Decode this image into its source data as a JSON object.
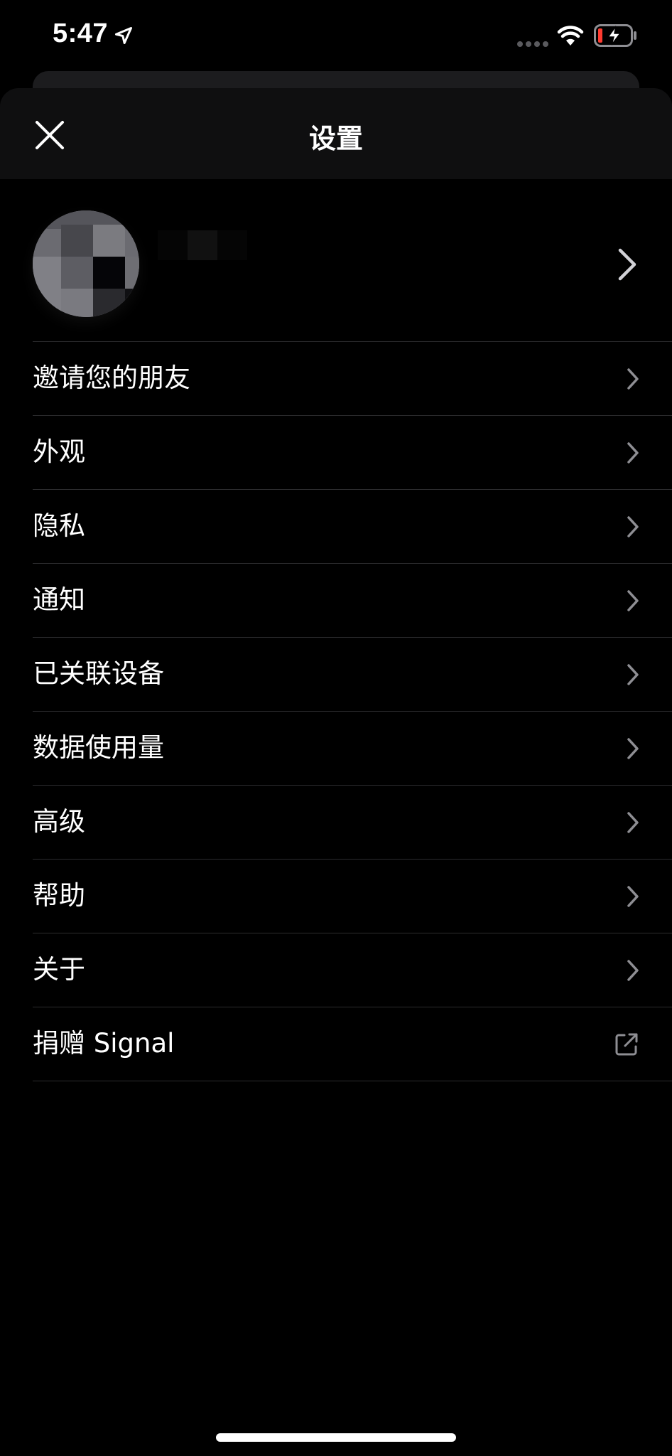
{
  "status_bar": {
    "time": "5:47"
  },
  "header": {
    "title": "设置",
    "close_icon": "close-icon"
  },
  "profile": {
    "chevron_icon": "chevron-right-icon"
  },
  "menu": {
    "items": [
      {
        "label": "邀请您的朋友",
        "icon": "chevron-right-icon"
      },
      {
        "label": "外观",
        "icon": "chevron-right-icon"
      },
      {
        "label": "隐私",
        "icon": "chevron-right-icon"
      },
      {
        "label": "通知",
        "icon": "chevron-right-icon"
      },
      {
        "label": "已关联设备",
        "icon": "chevron-right-icon"
      },
      {
        "label": "数据使用量",
        "icon": "chevron-right-icon"
      },
      {
        "label": "高级",
        "icon": "chevron-right-icon"
      },
      {
        "label": "帮助",
        "icon": "chevron-right-icon"
      },
      {
        "label": "关于",
        "icon": "chevron-right-icon"
      },
      {
        "label": "捐赠 Signal",
        "icon": "external-link-icon"
      }
    ]
  },
  "colors": {
    "background": "#000000",
    "nav_background": "#0f0f10",
    "separator": "#2c2c2e",
    "chevron": "#8e8e93",
    "battery_low": "#ff3b30"
  }
}
